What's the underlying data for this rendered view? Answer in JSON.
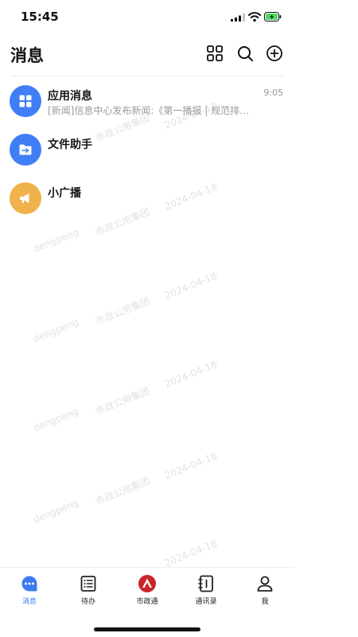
{
  "status_bar": {
    "time": "15:45"
  },
  "header": {
    "title": "消息"
  },
  "messages": [
    {
      "name": "应用消息",
      "preview": "[新闻]信息中心发布新闻:《第一播报 | 规范排…",
      "time": "9:05",
      "avatar_color": "#3f7ef5",
      "icon": "apps-icon"
    },
    {
      "name": "文件助手",
      "preview": "",
      "time": "",
      "avatar_color": "#3f7ef5",
      "icon": "folder-transfer-icon"
    },
    {
      "name": "小广播",
      "preview": "",
      "time": "",
      "avatar_color": "#f0b24a",
      "icon": "megaphone-icon"
    }
  ],
  "watermark": {
    "user": "dengpeng",
    "org": "市政公用集团",
    "date": "2024-04-18"
  },
  "tabs": [
    {
      "label": "消息",
      "icon": "chat-bubble-icon",
      "active": true
    },
    {
      "label": "待办",
      "icon": "todo-list-icon",
      "active": false
    },
    {
      "label": "市政通",
      "icon": "shizhengtong-logo-icon",
      "active": false
    },
    {
      "label": "通讯录",
      "icon": "address-book-icon",
      "active": false
    },
    {
      "label": "我",
      "icon": "profile-icon",
      "active": false
    }
  ],
  "colors": {
    "accent": "#3a7bf2",
    "app_avatar": "#3f7ef5",
    "broadcast_avatar": "#f0b24a",
    "logo_red": "#c8262b"
  }
}
